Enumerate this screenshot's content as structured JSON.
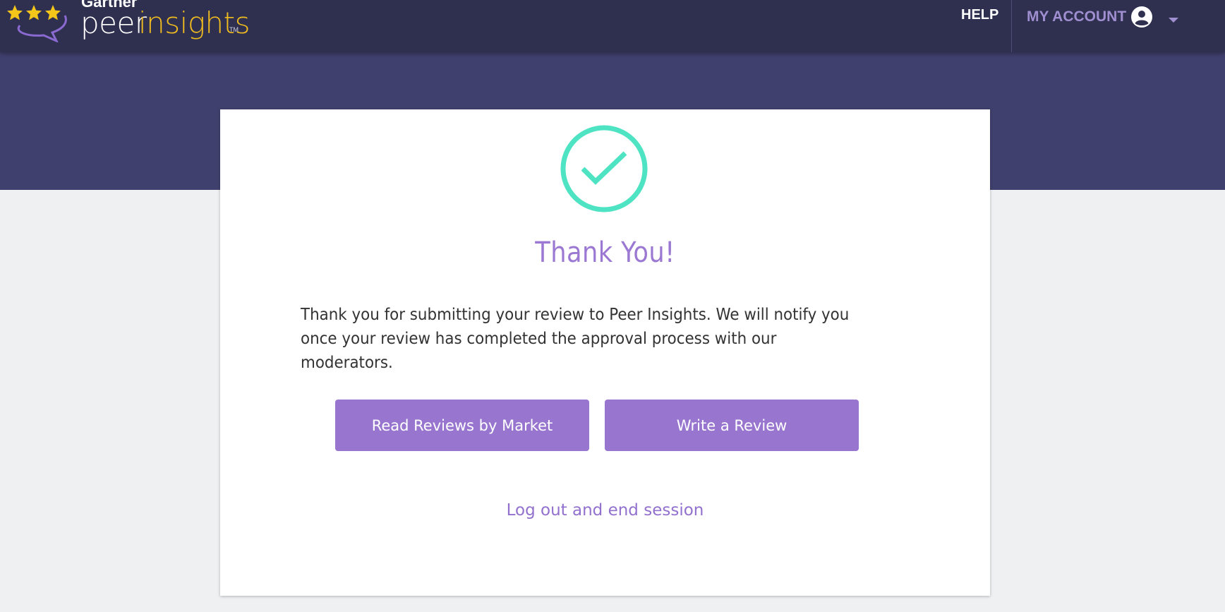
{
  "header": {
    "brand": {
      "gartner": "Gartner",
      "peer": "peer",
      "insights": "insights",
      "tm": "TM"
    },
    "help_label": "HELP",
    "account_label": "MY ACCOUNT",
    "icons": {
      "stars": "star-icon",
      "account": "account-circle-icon",
      "caret": "caret-down-icon"
    }
  },
  "main": {
    "success_icon": "checkmark-circle-icon",
    "title": "Thank You!",
    "message": "Thank you for submitting your review to Peer Insights. We will notify you once your review has completed the approval process with our moderators.",
    "buttons": {
      "read_reviews": "Read Reviews by Market",
      "write_review": "Write a Review"
    },
    "logout_label": "Log out and end session"
  },
  "colors": {
    "header_bg": "#2f3050",
    "band_bg": "#40406e",
    "accent_purple": "#9875cf",
    "check_teal": "#4ee3c2",
    "star_yellow": "#f5c61a",
    "insights_yellow": "#f0bb1e"
  }
}
